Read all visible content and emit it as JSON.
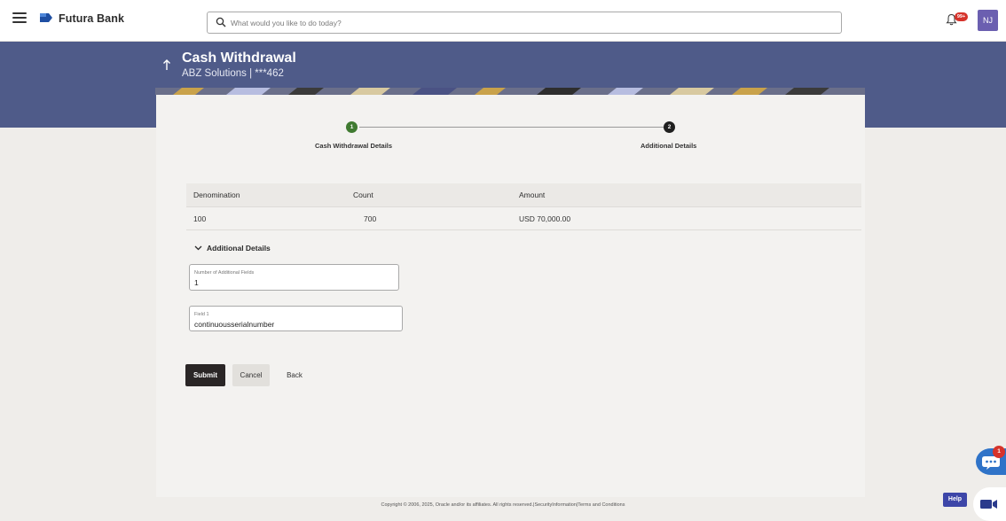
{
  "header": {
    "brand_name": "Futura Bank",
    "search_placeholder": "What would you like to do today?",
    "notification_badge": "99+",
    "avatar_initials": "NJ"
  },
  "page": {
    "title": "Cash Withdrawal",
    "subtitle": "ABZ Solutions | ***462"
  },
  "stepper": {
    "steps": [
      {
        "number": "1",
        "label": "Cash Withdrawal Details",
        "status": "complete"
      },
      {
        "number": "2",
        "label": "Additional Details",
        "status": "current"
      }
    ]
  },
  "denominations": {
    "columns": [
      "Denomination",
      "Count",
      "Amount"
    ],
    "rows": [
      {
        "denomination": "100",
        "count": "700",
        "amount": "USD 70,000.00"
      }
    ]
  },
  "additional_details": {
    "section_title": "Additional Details",
    "fields": [
      {
        "label": "Number of Additional Fields",
        "value": "1"
      },
      {
        "label": "Field 1",
        "value": "continuousserialnumber"
      }
    ]
  },
  "actions": {
    "submit": "Submit",
    "cancel": "Cancel",
    "back": "Back"
  },
  "footer": {
    "copyright": "Copyright © 2006, 2025, Oracle and/or its affiliates. All rights reserved.|SecurityInformation|Terms and Conditions"
  },
  "widgets": {
    "chat_badge": "1",
    "help_label": "Help"
  },
  "colors": {
    "banner": "#4f5b89",
    "step_complete": "#3f7a31",
    "step_current": "#1f1f1f",
    "submit_button": "#2a2626",
    "avatar": "#6b5fb0"
  }
}
